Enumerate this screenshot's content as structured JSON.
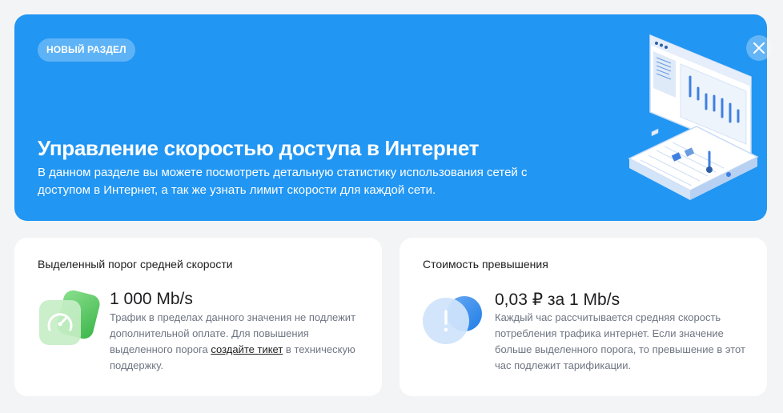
{
  "banner": {
    "badge": "НОВЫЙ РАЗДЕЛ",
    "title": "Управление скоростью доступа в Интернет",
    "description": "В данном разделе вы можете посмотреть детальную статистику использования сетей с доступом в Интернет, а так же узнать лимит скорости для каждой сети.",
    "accent_color": "#2196f3"
  },
  "cards": {
    "threshold": {
      "title": "Выделенный порог средней скорости",
      "value": "1 000 Mb/s",
      "text_before_link": "Трафик в пределах данного значения не подлежит дополнительной оплате. Для повышения выделенного порога ",
      "link_text": "создайте тикет",
      "text_after_link": " в техническую поддержку.",
      "icon": "speedometer-icon",
      "icon_color": "#4caf50"
    },
    "overage": {
      "title": "Стоимость превышения",
      "value": "0,03 ₽ за 1 Mb/s",
      "text": "Каждый час рассчитывается средняя скорость потребления трафика интернет. Если значение больше выделенного порога, то превышение в этот час подлежит тарификации.",
      "icon": "exclamation-icon",
      "icon_color": "#2196f3"
    }
  }
}
